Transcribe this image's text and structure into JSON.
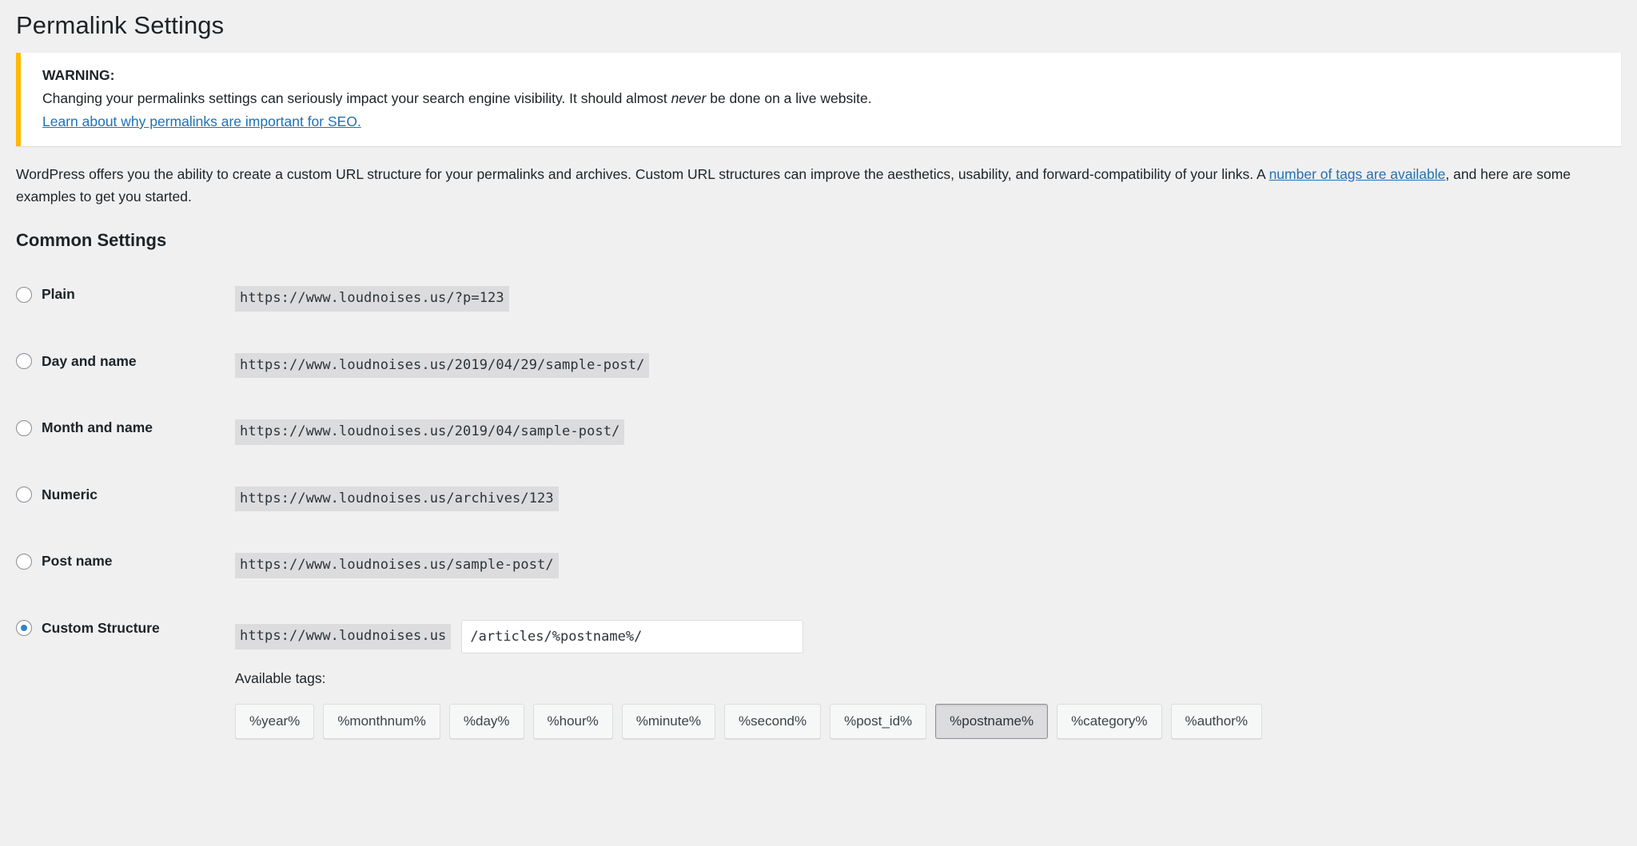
{
  "page": {
    "title": "Permalink Settings"
  },
  "notice": {
    "heading": "WARNING:",
    "body_before_em": "Changing your permalinks settings can seriously impact your search engine visibility. It should almost ",
    "body_em": "never",
    "body_after_em": " be done on a live website.",
    "link": "Learn about why permalinks are important for SEO.",
    "accent_color": "#ffb900"
  },
  "intro": {
    "text_before_link": "WordPress offers you the ability to create a custom URL structure for your permalinks and archives. Custom URL structures can improve the aesthetics, usability, and forward-compatibility of your links. A ",
    "link": "number of tags are available",
    "text_after_link": ", and here are some examples to get you started."
  },
  "common_settings": {
    "heading": "Common Settings",
    "options": [
      {
        "label": "Plain",
        "example": "https://www.loudnoises.us/?p=123",
        "selected": false
      },
      {
        "label": "Day and name",
        "example": "https://www.loudnoises.us/2019/04/29/sample-post/",
        "selected": false
      },
      {
        "label": "Month and name",
        "example": "https://www.loudnoises.us/2019/04/sample-post/",
        "selected": false
      },
      {
        "label": "Numeric",
        "example": "https://www.loudnoises.us/archives/123",
        "selected": false
      },
      {
        "label": "Post name",
        "example": "https://www.loudnoises.us/sample-post/",
        "selected": false
      }
    ],
    "custom": {
      "label": "Custom Structure",
      "selected": true,
      "prefix": "https://www.loudnoises.us",
      "input_value": "/articles/%postname%/",
      "input_placeholder": "",
      "available_tags_label": "Available tags:",
      "tags": [
        {
          "name": "%year%",
          "active": false
        },
        {
          "name": "%monthnum%",
          "active": false
        },
        {
          "name": "%day%",
          "active": false
        },
        {
          "name": "%hour%",
          "active": false
        },
        {
          "name": "%minute%",
          "active": false
        },
        {
          "name": "%second%",
          "active": false
        },
        {
          "name": "%post_id%",
          "active": false
        },
        {
          "name": "%postname%",
          "active": true
        },
        {
          "name": "%category%",
          "active": false
        },
        {
          "name": "%author%",
          "active": false
        }
      ]
    }
  },
  "colors": {
    "background": "#f0f0f1",
    "accent_link": "#2271b1",
    "radio_selected": "#3582c4",
    "code_background": "#dcdcde",
    "warning_border": "#ffb900"
  }
}
